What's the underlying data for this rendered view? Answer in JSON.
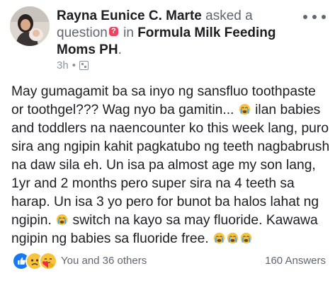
{
  "post": {
    "author": "Rayna Eunice C. Marte",
    "action": "asked a question",
    "preposition": "in",
    "group": "Formula Milk Feeding Moms PH",
    "period": ".",
    "time": "3h",
    "separator": "•",
    "privacy_icon": "group-privacy-icon",
    "body": {
      "s1": "May gumagamit ba sa inyo ng sansfluo toothpaste or toothgel??? Wag nyo ba gamitin...",
      "s2": "ilan babies and toddlers na naencounter ko this week lang, puro sira ang ngipin kahit pagkatubo ng teeth nagbabrush na daw sila eh. Un isa pa almost age my son lang, 1yr and 2 months pero super sira na 4 teeth sa harap. Un isa 3 yo pero for bunot ba halos lahat ng ngipin.",
      "s3": "switch na kayo sa may fluoride. Kawawa ngipin ng babies sa fluoride free."
    },
    "emoji": "crying-face"
  },
  "footer": {
    "reactions": [
      "like",
      "sad",
      "care"
    ],
    "reaction_text": "You and 36 others",
    "answers": "160 Answers"
  },
  "colors": {
    "name": "#1c1e21",
    "muted": "#606770",
    "like_blue": "#1877f2",
    "emoji_yellow": "#f7c23c",
    "question_pink": "#e9455f"
  }
}
